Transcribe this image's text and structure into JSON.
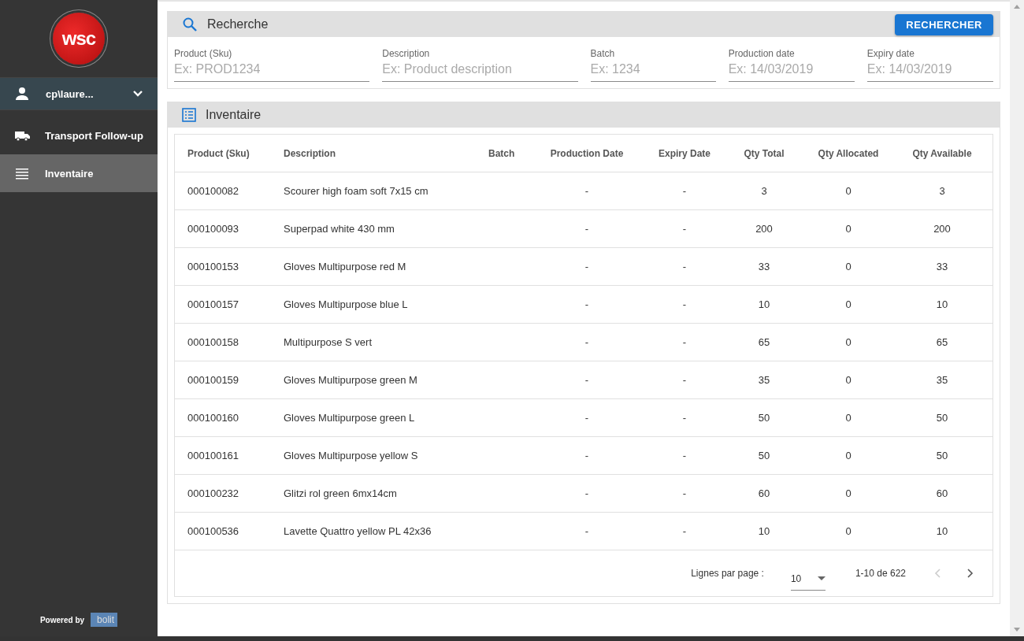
{
  "sidebar": {
    "logo_text": "wsc",
    "user": {
      "name": "cp\\laure...",
      "expanded": false
    },
    "items": [
      {
        "label": "Transport Follow-up",
        "selected": false
      },
      {
        "label": "Inventaire",
        "selected": true
      }
    ],
    "footer": {
      "powered_by": "Powered by",
      "brand": "bolit"
    }
  },
  "search": {
    "title": "Recherche",
    "button": "RECHERCHER",
    "fields": [
      {
        "label": "Product (Sku)",
        "placeholder": "Ex: PROD1234"
      },
      {
        "label": "Description",
        "placeholder": "Ex: Product description"
      },
      {
        "label": "Batch",
        "placeholder": "Ex: 1234"
      },
      {
        "label": "Production date",
        "placeholder": "Ex: 14/03/2019"
      },
      {
        "label": "Expiry date",
        "placeholder": "Ex: 14/03/2019"
      }
    ]
  },
  "inventory": {
    "title": "Inventaire",
    "table": {
      "columns": [
        "Product (Sku)",
        "Description",
        "Batch",
        "Production Date",
        "Expiry Date",
        "Qty Total",
        "Qty Allocated",
        "Qty Available"
      ],
      "rows": [
        [
          "000100082",
          "Scourer high foam soft 7x15 cm",
          "",
          "-",
          "-",
          "3",
          "0",
          "3"
        ],
        [
          "000100093",
          "Superpad white 430 mm",
          "",
          "-",
          "-",
          "200",
          "0",
          "200"
        ],
        [
          "000100153",
          "Gloves Multipurpose red M",
          "",
          "-",
          "-",
          "33",
          "0",
          "33"
        ],
        [
          "000100157",
          "Gloves Multipurpose blue L",
          "",
          "-",
          "-",
          "10",
          "0",
          "10"
        ],
        [
          "000100158",
          "Multipurpose S vert",
          "",
          "-",
          "-",
          "65",
          "0",
          "65"
        ],
        [
          "000100159",
          "Gloves Multipurpose green M",
          "",
          "-",
          "-",
          "35",
          "0",
          "35"
        ],
        [
          "000100160",
          "Gloves Multipurpose green L",
          "",
          "-",
          "-",
          "50",
          "0",
          "50"
        ],
        [
          "000100161",
          "Gloves Multipurpose yellow S",
          "",
          "-",
          "-",
          "50",
          "0",
          "50"
        ],
        [
          "000100232",
          "Glitzi rol green 6mx14cm",
          "",
          "-",
          "-",
          "60",
          "0",
          "60"
        ],
        [
          "000100536",
          "Lavette Quattro yellow PL 42x36",
          "",
          "-",
          "-",
          "10",
          "0",
          "10"
        ]
      ]
    },
    "pagination": {
      "rows_label": "Lignes par page :",
      "rows_per_page": "10",
      "range": "1-10 de 622",
      "prev_disabled": true,
      "next_disabled": false
    }
  }
}
